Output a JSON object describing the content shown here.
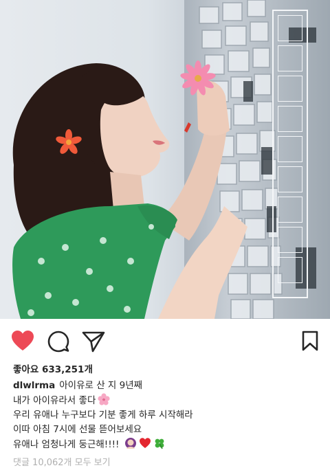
{
  "post": {
    "likes_text": "좋아요 633,251개",
    "username": "dlwlrma",
    "caption_first": "아이유로 산 지 9년째",
    "caption_lines": [
      "내가 아이유라서 좋다",
      "우리 유애나 누구보다 기분 좋게 하루 시작해라",
      "이따 아침 7시에 선물 뜯어보세요",
      "유애나 엄청나게 둥근해!!!!"
    ],
    "comments_link": "댓글 10,062개 모두 보기",
    "liked": true
  },
  "actions": {
    "like_icon": "heart-filled-icon",
    "comment_icon": "comment-bubble-icon",
    "share_icon": "paper-plane-icon",
    "save_icon": "bookmark-icon"
  },
  "colors": {
    "like_red": "#ed4956",
    "text_dark": "#262626",
    "muted": "#b0b0b0",
    "dress_green": "#2e9a5a"
  }
}
